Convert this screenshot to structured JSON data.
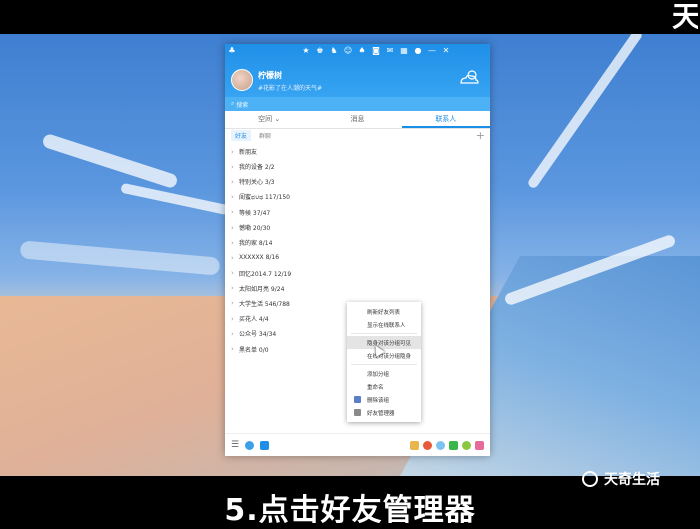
{
  "overlay": {
    "top_glyph": "天",
    "caption": "5.点击好友管理器",
    "brand": "天奇生活"
  },
  "qq": {
    "toolbar_icons": [
      "qq-logo-icon",
      "star-icon",
      "skin-icon",
      "dragon-icon",
      "pet-icon",
      "game-icon",
      "camera-icon",
      "mail-icon",
      "grid-icon",
      "alert-icon",
      "minimize-icon",
      "close-icon"
    ],
    "toolbar_glyphs": [
      "♣",
      "★",
      "♚",
      "♞",
      "☺",
      "♠",
      "◙",
      "✉",
      "▦",
      "●",
      "—",
      "✕"
    ],
    "nickname": "柠檬树",
    "signature": "#花影了在人潮的天气#",
    "search_placeholder": "搜索",
    "tabs": [
      {
        "label": "空间",
        "arrow": "⌄"
      },
      {
        "label": "消息",
        "arrow": ""
      },
      {
        "label": "联系人",
        "arrow": ""
      }
    ],
    "subtabs": [
      "好友",
      "群聊"
    ],
    "groups": [
      "新朋友",
      "我的设备 2/2",
      "特别关心 3/3",
      "闺蜜ಥ∪ಥ 117/150",
      "等候 37/47",
      "憾嘞 20/30",
      "我的家 8/14",
      "XXXXXX 8/16",
      "回忆2014.7 12/19",
      "太阳如月亮 9/24",
      "大学生活 546/788",
      "买花人 4/4",
      "公众号 34/34",
      "黑名单 0/0"
    ],
    "colors": {
      "header": "#1f8fe8",
      "accent": "#1a8fe6"
    }
  },
  "context_menu": {
    "items": [
      {
        "label": "刷新好友列表",
        "icon": ""
      },
      {
        "label": "显示在线联系人",
        "icon": ""
      },
      {
        "label": "隐身对该分组可见",
        "icon": ""
      },
      {
        "label": "在线对该分组隐身",
        "icon": ""
      },
      {
        "label": "添加分组",
        "icon": ""
      },
      {
        "label": "重命名",
        "icon": ""
      },
      {
        "label": "删除该组",
        "icon": "delete-icon"
      },
      {
        "label": "好友管理器",
        "icon": "friend-manager-icon"
      }
    ]
  }
}
